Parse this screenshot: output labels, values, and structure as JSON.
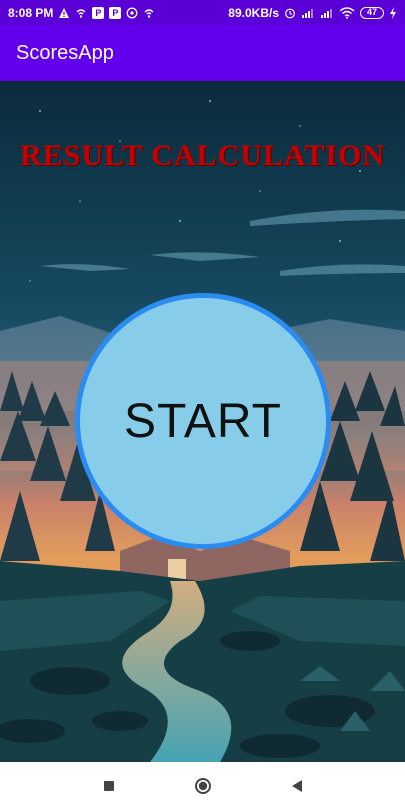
{
  "status_bar": {
    "time": "8:08 PM",
    "network_speed": "89.0KB/s",
    "battery_level": "47",
    "icons": [
      "warning-icon",
      "wifi-call-icon",
      "p-badge-icon",
      "p-badge-icon",
      "whatsapp-icon",
      "wifi-call-icon",
      "alarm-icon",
      "signal-icon",
      "signal-icon",
      "wifi-icon",
      "battery-icon",
      "charging-icon"
    ]
  },
  "app_bar": {
    "title": "ScoresApp"
  },
  "main": {
    "heading": "RESULT CALCULATION",
    "start_label": "START"
  },
  "nav": {
    "icons": [
      "recent-apps-icon",
      "home-icon",
      "back-icon"
    ]
  },
  "colors": {
    "status_bar": "#5a00d6",
    "app_bar": "#6200ee",
    "heading": "#c40000",
    "start_fill": "#87cdea",
    "start_border": "#2a8cf0"
  }
}
